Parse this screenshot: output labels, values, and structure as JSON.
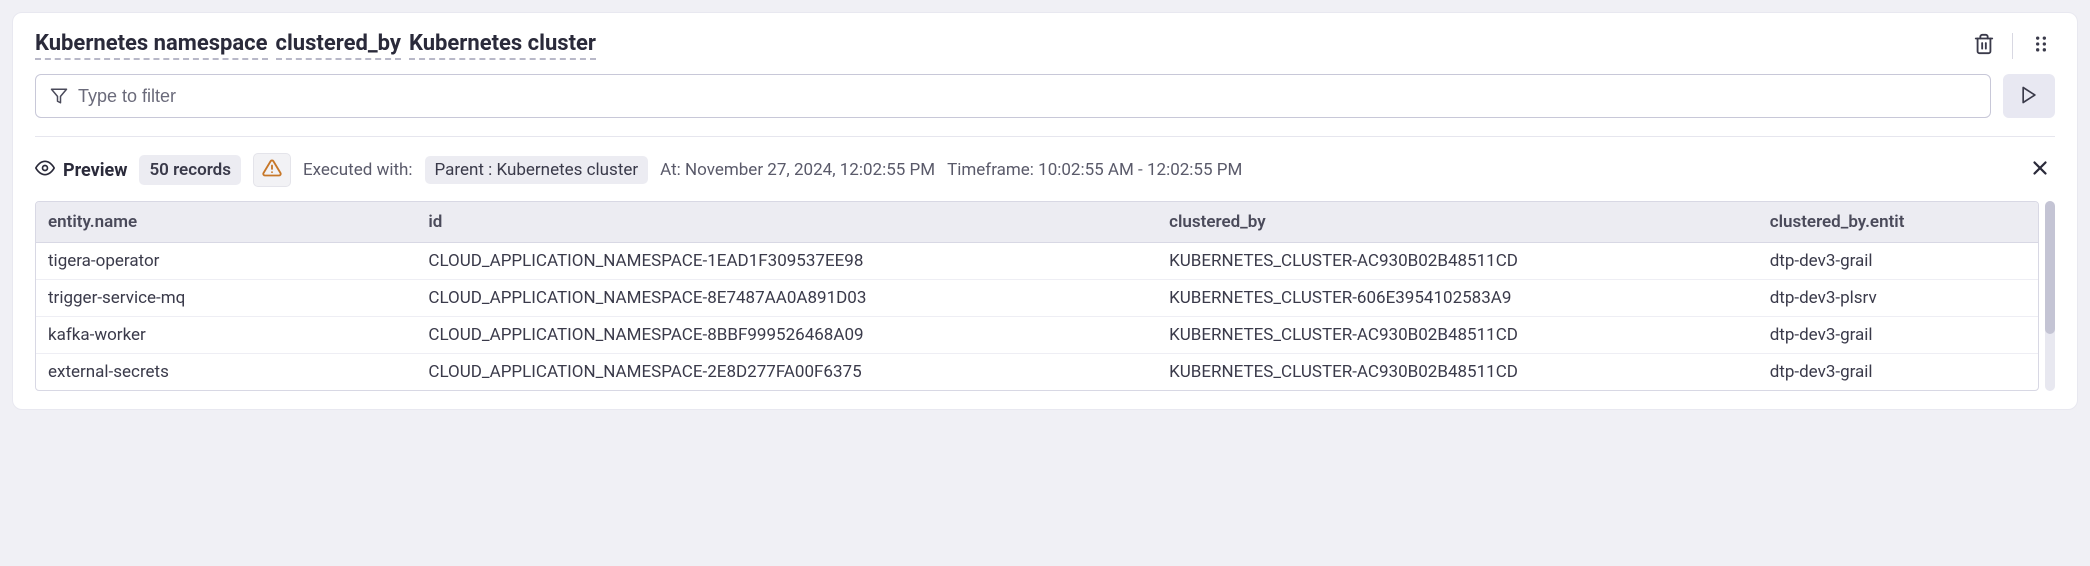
{
  "header": {
    "title_segments": [
      "Kubernetes namespace",
      "clustered_by",
      "Kubernetes cluster"
    ]
  },
  "filter": {
    "placeholder": "Type to filter",
    "value": ""
  },
  "preview": {
    "label": "Preview",
    "records_badge": "50 records",
    "executed_with_label": "Executed with:",
    "parent_badge": "Parent : Kubernetes cluster",
    "at_text": "At: November 27, 2024, 12:02:55 PM",
    "timeframe_text": "Timeframe: 10:02:55 AM - 12:02:55 PM"
  },
  "table": {
    "columns": [
      "entity.name",
      "id",
      "clustered_by",
      "clustered_by.entit"
    ],
    "rows": [
      {
        "name": "tigera-operator",
        "id": "CLOUD_APPLICATION_NAMESPACE-1EAD1F309537EE98",
        "clustered_by": "KUBERNETES_CLUSTER-AC930B02B48511CD",
        "entity": "dtp-dev3-grail"
      },
      {
        "name": "trigger-service-mq",
        "id": "CLOUD_APPLICATION_NAMESPACE-8E7487AA0A891D03",
        "clustered_by": "KUBERNETES_CLUSTER-606E3954102583A9",
        "entity": "dtp-dev3-plsrv"
      },
      {
        "name": "kafka-worker",
        "id": "CLOUD_APPLICATION_NAMESPACE-8BBF999526468A09",
        "clustered_by": "KUBERNETES_CLUSTER-AC930B02B48511CD",
        "entity": "dtp-dev3-grail"
      },
      {
        "name": "external-secrets",
        "id": "CLOUD_APPLICATION_NAMESPACE-2E8D277FA00F6375",
        "clustered_by": "KUBERNETES_CLUSTER-AC930B02B48511CD",
        "entity": "dtp-dev3-grail"
      }
    ]
  }
}
